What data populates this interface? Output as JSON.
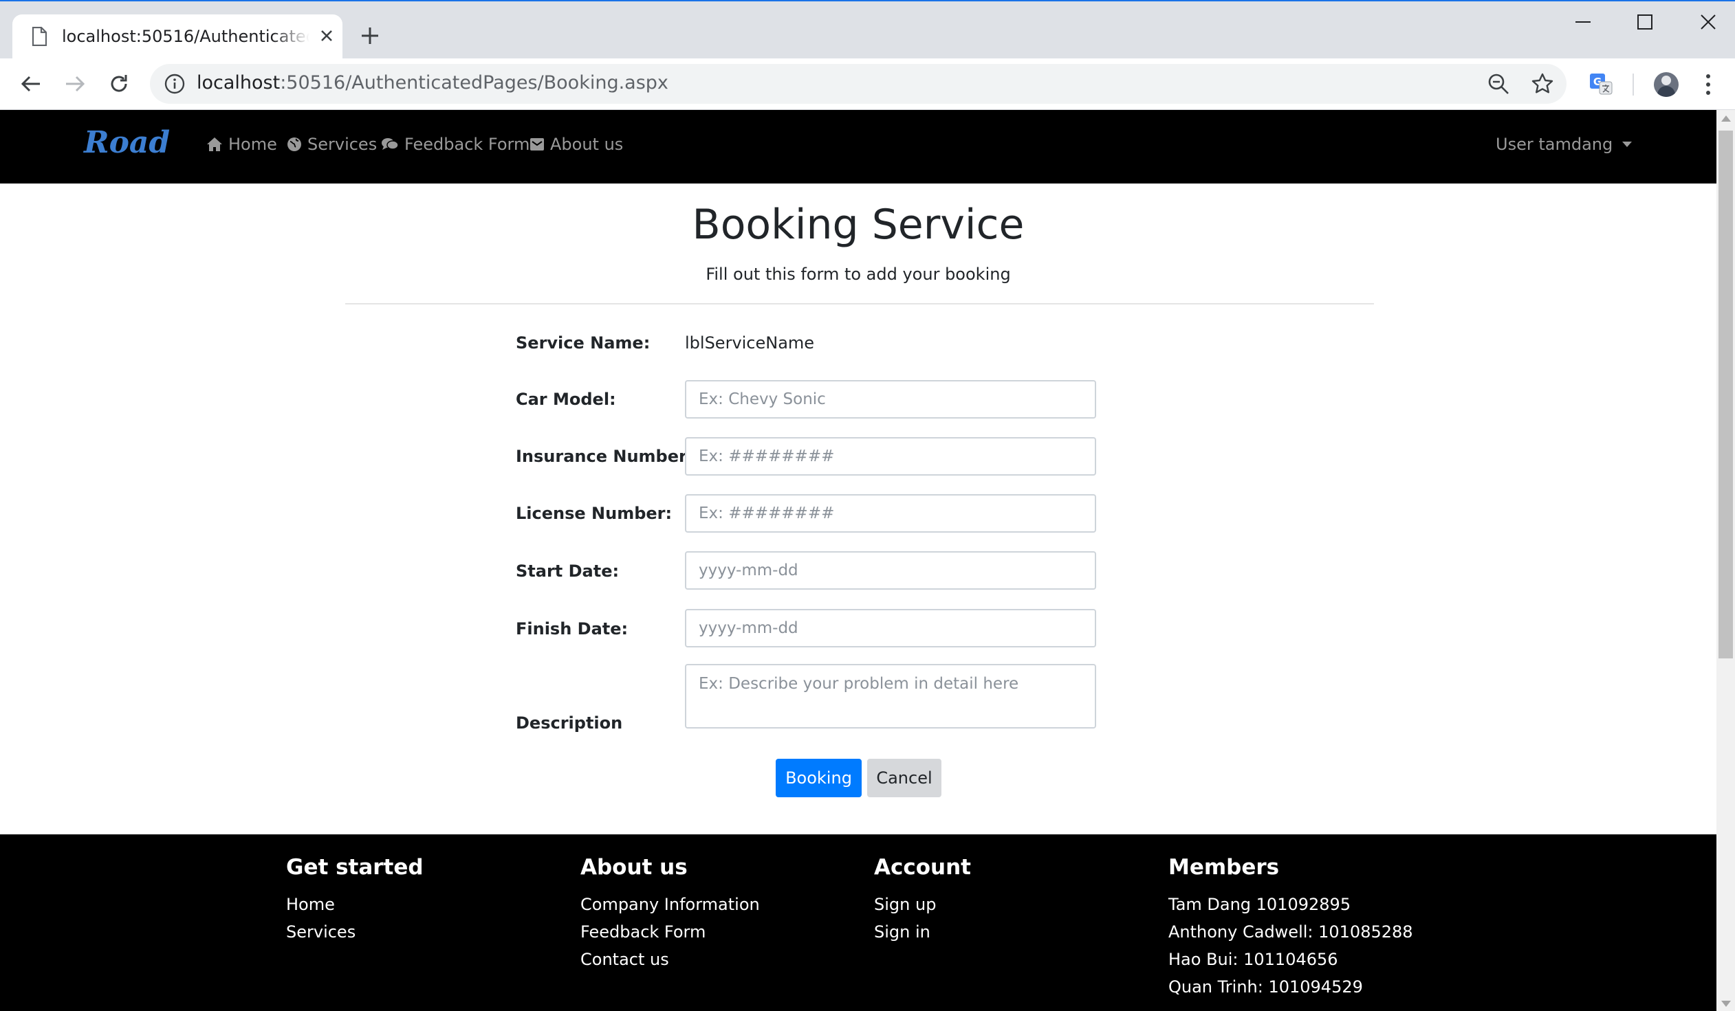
{
  "browser": {
    "tab_title": "localhost:50516/AuthenticatedPages/Booking.aspx",
    "url_host": "localhost",
    "url_rest": ":50516/AuthenticatedPages/Booking.aspx"
  },
  "navbar": {
    "brand": "Road",
    "links": [
      {
        "label": "Home",
        "icon": "home-icon"
      },
      {
        "label": "Services",
        "icon": "globe-icon"
      },
      {
        "label": "Feedback Form",
        "icon": "comments-icon"
      },
      {
        "label": "About us",
        "icon": "envelope-icon"
      }
    ],
    "user_menu": "User tamdang"
  },
  "page": {
    "title": "Booking Service",
    "subtitle": "Fill out this form to add your booking"
  },
  "form": {
    "service_name": {
      "label": "Service Name:",
      "value": "lblServiceName"
    },
    "car_model": {
      "label": "Car Model:",
      "placeholder": "Ex: Chevy Sonic"
    },
    "insurance_number": {
      "label": "Insurance Number:",
      "placeholder": "Ex: ########"
    },
    "license_number": {
      "label": "License Number:",
      "placeholder": "Ex: ########"
    },
    "start_date": {
      "label": "Start Date:",
      "placeholder": "yyyy-mm-dd"
    },
    "finish_date": {
      "label": "Finish Date:",
      "placeholder": "yyyy-mm-dd"
    },
    "description": {
      "label": "Description",
      "placeholder": "Ex: Describe your problem in detail here"
    },
    "booking_button": "Booking",
    "cancel_button": "Cancel"
  },
  "footer": {
    "get_started": {
      "heading": "Get started",
      "items": [
        "Home",
        "Services"
      ]
    },
    "about_us": {
      "heading": "About us",
      "items": [
        "Company Information",
        "Feedback Form",
        "Contact us"
      ]
    },
    "account": {
      "heading": "Account",
      "items": [
        "Sign up",
        "Sign in"
      ]
    },
    "members": {
      "heading": "Members",
      "items": [
        "Tam Dang 101092895",
        "Anthony Cadwell: 101085288",
        "Hao Bui: 101104656",
        "Quan Trinh: 101094529"
      ]
    }
  },
  "colors": {
    "accent": "#007bff",
    "brand": "#3c7ed1",
    "navbar_bg": "#000000"
  }
}
